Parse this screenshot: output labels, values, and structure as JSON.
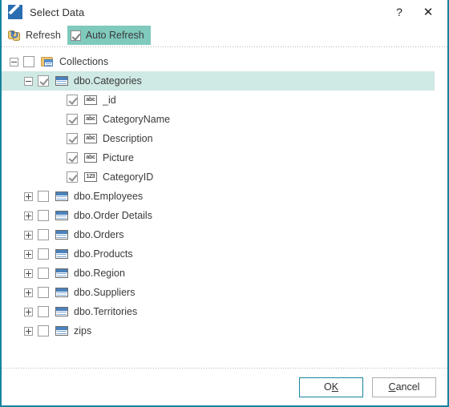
{
  "window": {
    "title": "Select Data",
    "icon": "select-data-icon",
    "accent_color": "#17849e",
    "titlebar_background": "#ffffff",
    "help_button": "?",
    "close_button": "✕"
  },
  "toolbar": {
    "refresh": {
      "label": "Refresh",
      "icon": "refresh-icon",
      "pressed": false
    },
    "auto_refresh": {
      "label": "Auto Refresh",
      "icon": "checkbox-icon",
      "checked": true,
      "pressed": true,
      "pressed_color": "#7fc9bd"
    }
  },
  "tree": {
    "selection_color": "#cfe9e4",
    "nodes": [
      {
        "label": "Collections",
        "level": 1,
        "icon": "folder-collections-icon",
        "expander": "minus",
        "checked": false
      },
      {
        "label": "dbo.Categories",
        "level": 2,
        "icon": "table-icon",
        "expander": "minus",
        "checked": true,
        "selected": true
      },
      {
        "label": "_id",
        "level": 3,
        "icon": "field-text-icon",
        "field_type": "abc",
        "expander": "none",
        "checked": true
      },
      {
        "label": "CategoryName",
        "level": 3,
        "icon": "field-text-icon",
        "field_type": "abc",
        "expander": "none",
        "checked": true
      },
      {
        "label": "Description",
        "level": 3,
        "icon": "field-text-icon",
        "field_type": "abc",
        "expander": "none",
        "checked": true
      },
      {
        "label": "Picture",
        "level": 3,
        "icon": "field-text-icon",
        "field_type": "abc",
        "expander": "none",
        "checked": true
      },
      {
        "label": "CategoryID",
        "level": 3,
        "icon": "field-number-icon",
        "field_type": "123",
        "expander": "none",
        "checked": true
      },
      {
        "label": "dbo.Employees",
        "level": 2,
        "icon": "table-icon",
        "expander": "plus",
        "checked": false
      },
      {
        "label": "dbo.Order Details",
        "level": 2,
        "icon": "table-icon",
        "expander": "plus",
        "checked": false
      },
      {
        "label": "dbo.Orders",
        "level": 2,
        "icon": "table-icon",
        "expander": "plus",
        "checked": false
      },
      {
        "label": "dbo.Products",
        "level": 2,
        "icon": "table-icon",
        "expander": "plus",
        "checked": false
      },
      {
        "label": "dbo.Region",
        "level": 2,
        "icon": "table-icon",
        "expander": "plus",
        "checked": false
      },
      {
        "label": "dbo.Suppliers",
        "level": 2,
        "icon": "table-icon",
        "expander": "plus",
        "checked": false
      },
      {
        "label": "dbo.Territories",
        "level": 2,
        "icon": "table-icon",
        "expander": "plus",
        "checked": false
      },
      {
        "label": "zips",
        "level": 2,
        "icon": "table-icon",
        "expander": "plus",
        "checked": false
      }
    ]
  },
  "footer": {
    "ok": {
      "label": "OK",
      "accesskey": "K",
      "default": true
    },
    "cancel": {
      "label": "Cancel",
      "accesskey": "C",
      "default": false
    }
  }
}
